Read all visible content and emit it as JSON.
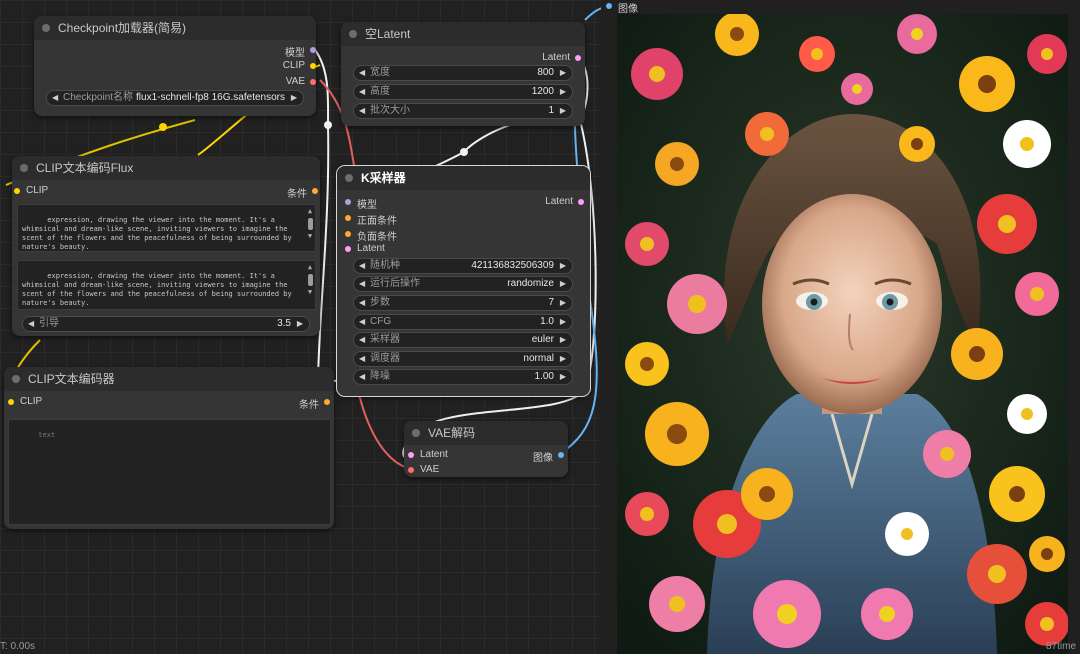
{
  "colors": {
    "model": "#b39ddb",
    "clip": "#ffd500",
    "vae": "#ff6e6e",
    "conditioning": "#ffa931",
    "latent": "#ff9cf9",
    "image": "#64b5f6"
  },
  "nodes": {
    "checkpoint": {
      "title": "Checkpoint加载器(简易)",
      "outputs": [
        "模型",
        "CLIP",
        "VAE"
      ],
      "ckpt_label": "Checkpoint名称",
      "ckpt_value": "flux1-schnell-fp8 16G.safetensors"
    },
    "empty_latent": {
      "title": "空Latent",
      "output": "Latent",
      "widgets": [
        {
          "label": "宽度",
          "value": "800"
        },
        {
          "label": "高度",
          "value": "1200"
        },
        {
          "label": "批次大小",
          "value": "1"
        }
      ]
    },
    "clip_flux": {
      "title": "CLIP文本编码Flux",
      "input": "CLIP",
      "output": "条件",
      "text1": "expression, drawing the viewer into the moment. It's a whimsical and dream-like scene, inviting viewers to imagine the scent of the flowers and the peacefulness of being surrounded by nature's beauty.",
      "text2": "expression, drawing the viewer into the moment. It's a whimsical and dream-like scene, inviting viewers to imagine the scent of the flowers and the peacefulness of being surrounded by nature's beauty.",
      "guidance_label": "引导",
      "guidance_value": "3.5"
    },
    "clip_encode": {
      "title": "CLIP文本编码器",
      "input": "CLIP",
      "output": "条件",
      "text": "text"
    },
    "ksampler": {
      "title": "K采样器",
      "inputs": [
        "模型",
        "正面条件",
        "负面条件",
        "Latent"
      ],
      "output": "Latent",
      "widgets": [
        {
          "label": "随机种",
          "value": "421136832506309"
        },
        {
          "label": "运行后操作",
          "value": "randomize"
        },
        {
          "label": "步数",
          "value": "7"
        },
        {
          "label": "CFG",
          "value": "1.0"
        },
        {
          "label": "采样器",
          "value": "euler"
        },
        {
          "label": "调度器",
          "value": "normal"
        },
        {
          "label": "降噪",
          "value": "1.00"
        }
      ]
    },
    "vae_decode": {
      "title": "VAE解码",
      "inputs": [
        "Latent",
        "VAE"
      ],
      "output": "图像"
    },
    "preview": {
      "input_label": "图像",
      "time_label": "87time"
    }
  },
  "status": {
    "time": "T: 0.00s"
  }
}
